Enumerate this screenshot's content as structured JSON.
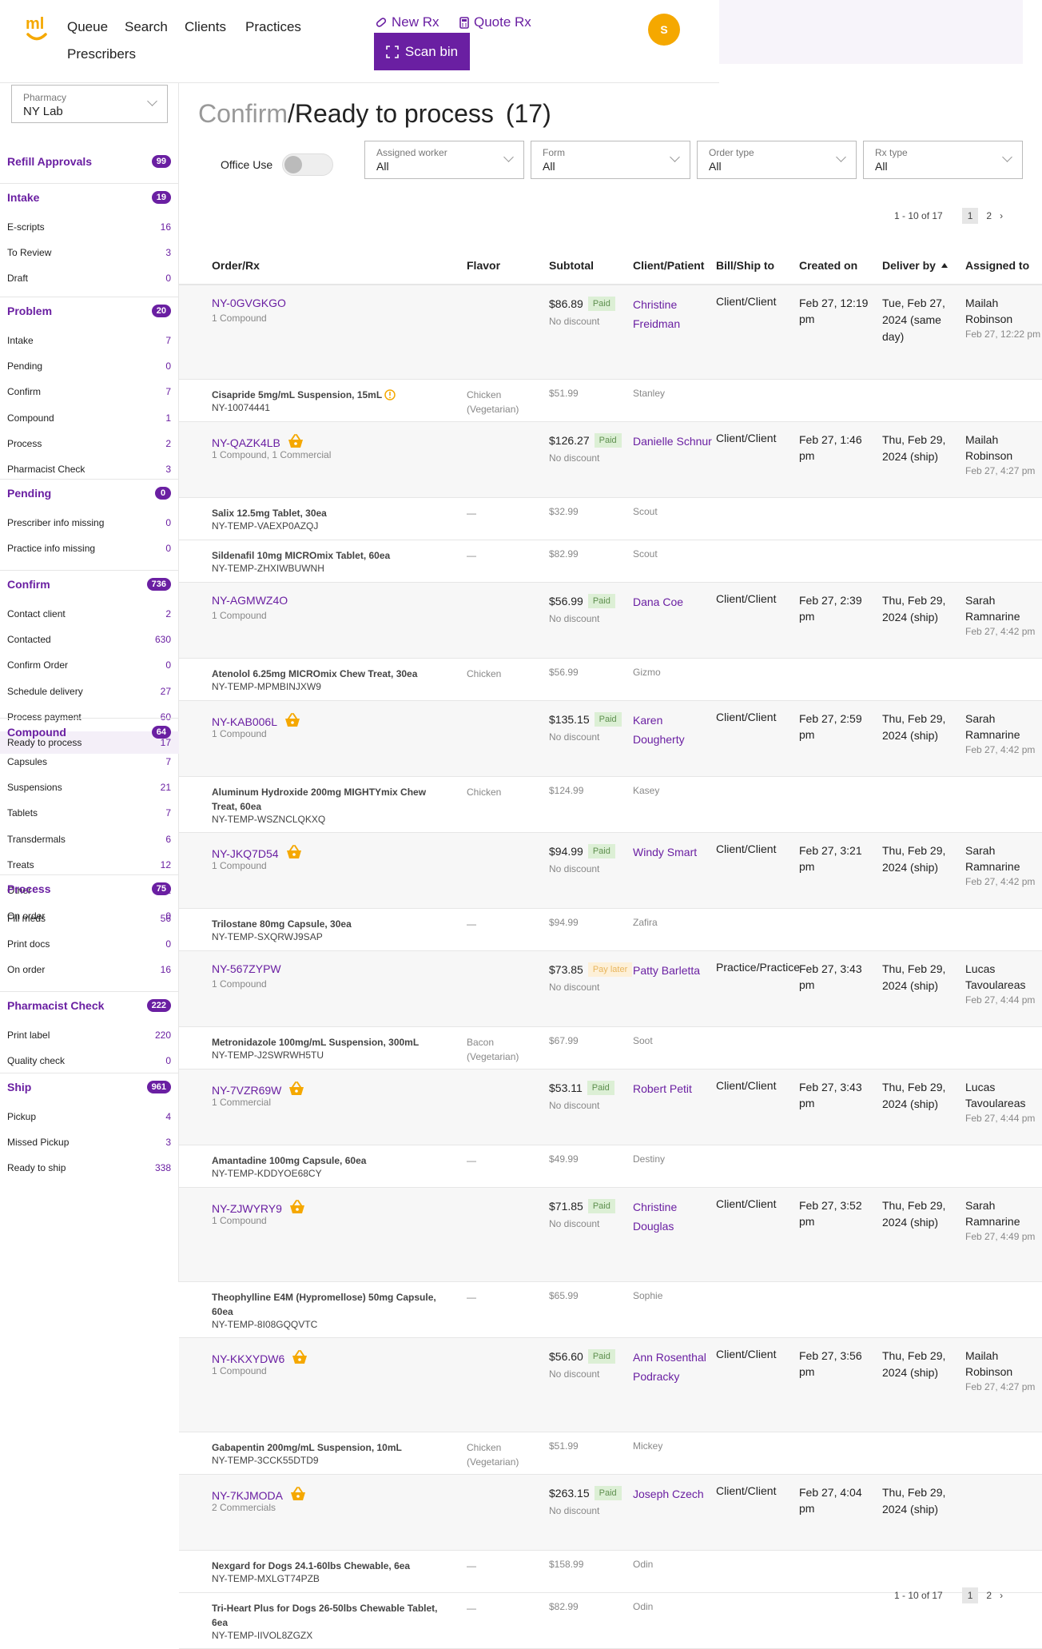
{
  "nav": {
    "queue": "Queue",
    "search": "Search",
    "clients": "Clients",
    "practices": "Practices",
    "prescribers": "Prescribers",
    "new_rx": "New Rx",
    "quote_rx": "Quote Rx",
    "scan_bin": "Scan bin",
    "avatar": "S"
  },
  "pharmacy": {
    "label": "Pharmacy",
    "value": "NY Lab"
  },
  "sidebar": [
    {
      "label": "Refill Approvals",
      "count": "99",
      "items": []
    },
    {
      "label": "Intake",
      "count": "19",
      "items": [
        {
          "label": "E-scripts",
          "count": "16"
        },
        {
          "label": "To Review",
          "count": "3"
        },
        {
          "label": "Draft",
          "count": "0"
        }
      ]
    },
    {
      "label": "Problem",
      "count": "20",
      "items": [
        {
          "label": "Intake",
          "count": "7"
        },
        {
          "label": "Pending",
          "count": "0"
        },
        {
          "label": "Confirm",
          "count": "7"
        },
        {
          "label": "Compound",
          "count": "1"
        },
        {
          "label": "Process",
          "count": "2"
        },
        {
          "label": "Pharmacist Check",
          "count": "3"
        }
      ]
    },
    {
      "label": "Pending",
      "count": "0",
      "items": [
        {
          "label": "Prescriber info missing",
          "count": "0"
        },
        {
          "label": "Practice info missing",
          "count": "0"
        }
      ]
    },
    {
      "label": "Confirm",
      "count": "736",
      "items": [
        {
          "label": "Contact client",
          "count": "2"
        },
        {
          "label": "Contacted",
          "count": "630"
        },
        {
          "label": "Confirm Order",
          "count": "0"
        },
        {
          "label": "Schedule delivery",
          "count": "27"
        },
        {
          "label": "Process payment",
          "count": "60"
        },
        {
          "label": "Ready to process",
          "count": "17"
        }
      ]
    },
    {
      "label": "Compound",
      "count": "64",
      "items": [
        {
          "label": "Capsules",
          "count": "7"
        },
        {
          "label": "Suspensions",
          "count": "21"
        },
        {
          "label": "Tablets",
          "count": "7"
        },
        {
          "label": "Transdermals",
          "count": "6"
        },
        {
          "label": "Treats",
          "count": "12"
        },
        {
          "label": "Other",
          "count": "11"
        },
        {
          "label": "On order",
          "count": "0"
        }
      ]
    },
    {
      "label": "Process",
      "count": "75",
      "items": [
        {
          "label": "Fill meds",
          "count": "56"
        },
        {
          "label": "Print docs",
          "count": "0"
        },
        {
          "label": "On order",
          "count": "16"
        }
      ]
    },
    {
      "label": "Pharmacist Check",
      "count": "222",
      "items": [
        {
          "label": "Print label",
          "count": "220"
        },
        {
          "label": "Quality check",
          "count": "0"
        }
      ]
    },
    {
      "label": "Ship",
      "count": "961",
      "items": [
        {
          "label": "Pickup",
          "count": "4"
        },
        {
          "label": "Missed Pickup",
          "count": "3"
        },
        {
          "label": "Ready to ship",
          "count": "338"
        }
      ]
    }
  ],
  "page": {
    "title_prefix": "Confirm",
    "title_sep": "/",
    "title": "Ready to process",
    "count": "(17)",
    "office_use": "Office Use"
  },
  "filters": [
    {
      "label": "Assigned worker",
      "value": "All"
    },
    {
      "label": "Form",
      "value": "All"
    },
    {
      "label": "Order type",
      "value": "All"
    },
    {
      "label": "Rx type",
      "value": "All"
    }
  ],
  "pagination": {
    "range": "1 - 10 of 17",
    "page1": "1",
    "page2": "2",
    "next": "›"
  },
  "columns": {
    "order": "Order/Rx",
    "flavor": "Flavor",
    "subtotal": "Subtotal",
    "client": "Client/Patient",
    "bill": "Bill/Ship to",
    "created": "Created on",
    "deliver": "Deliver by",
    "assigned": "Assigned to"
  },
  "orders": [
    {
      "id": "NY-0GVGKGO",
      "sub": "1 Compound",
      "basket": false,
      "price": "$86.89",
      "status": "Paid",
      "discount": "No discount",
      "client": "Christine Freidman",
      "bill": "Client/Client",
      "created": "Feb 27, 12:19 pm",
      "deliver": "Tue, Feb 27, 2024 (same day)",
      "assigned": "Mailah Robinson",
      "assigned_at": "Feb 27, 12:22 pm",
      "items": [
        {
          "name": "Cisapride 5mg/mL Suspension, 15mL",
          "warn": true,
          "rx": "NY-10074441",
          "flavor": "Chicken (Vegetarian)",
          "price": "$51.99",
          "pet": "Stanley"
        }
      ]
    },
    {
      "id": "NY-QAZK4LB",
      "sub": "1 Compound, 1 Commercial",
      "basket": true,
      "price": "$126.27",
      "status": "Paid",
      "discount": "No discount",
      "client": "Danielle Schnur",
      "bill": "Client/Client",
      "created": "Feb 27, 1:46 pm",
      "deliver": "Thu, Feb 29, 2024 (ship)",
      "assigned": "Mailah Robinson",
      "assigned_at": "Feb 27, 4:27 pm",
      "items": [
        {
          "name": "Salix 12.5mg Tablet, 30ea",
          "warn": false,
          "rx": "NY-TEMP-VAEXP0AZQJ",
          "flavor": "—",
          "price": "$32.99",
          "pet": "Scout"
        },
        {
          "name": "Sildenafil 10mg MICROmix Tablet, 60ea",
          "warn": false,
          "rx": "NY-TEMP-ZHXIWBUWNH",
          "flavor": "—",
          "price": "$82.99",
          "pet": "Scout"
        }
      ]
    },
    {
      "id": "NY-AGMWZ4O",
      "sub": "1 Compound",
      "basket": false,
      "price": "$56.99",
      "status": "Paid",
      "discount": "No discount",
      "client": "Dana Coe",
      "bill": "Client/Client",
      "created": "Feb 27, 2:39 pm",
      "deliver": "Thu, Feb 29, 2024 (ship)",
      "assigned": "Sarah Ramnarine",
      "assigned_at": "Feb 27, 4:42 pm",
      "items": [
        {
          "name": "Atenolol 6.25mg MICROmix Chew Treat, 30ea",
          "warn": false,
          "rx": "NY-TEMP-MPMBINJXW9",
          "flavor": "Chicken",
          "price": "$56.99",
          "pet": "Gizmo"
        }
      ]
    },
    {
      "id": "NY-KAB006L",
      "sub": "1 Compound",
      "basket": true,
      "price": "$135.15",
      "status": "Paid",
      "discount": "No discount",
      "client": "Karen Dougherty",
      "bill": "Client/Client",
      "created": "Feb 27, 2:59 pm",
      "deliver": "Thu, Feb 29, 2024 (ship)",
      "assigned": "Sarah Ramnarine",
      "assigned_at": "Feb 27, 4:42 pm",
      "items": [
        {
          "name": "Aluminum Hydroxide 200mg MIGHTYmix Chew Treat, 60ea",
          "warn": false,
          "rx": "NY-TEMP-WSZNCLQKXQ",
          "flavor": "Chicken",
          "price": "$124.99",
          "pet": "Kasey"
        }
      ]
    },
    {
      "id": "NY-JKQ7D54",
      "sub": "1 Compound",
      "basket": true,
      "price": "$94.99",
      "status": "Paid",
      "discount": "No discount",
      "client": "Windy Smart",
      "bill": "Client/Client",
      "created": "Feb 27, 3:21 pm",
      "deliver": "Thu, Feb 29, 2024 (ship)",
      "assigned": "Sarah Ramnarine",
      "assigned_at": "Feb 27, 4:42 pm",
      "items": [
        {
          "name": "Trilostane 80mg Capsule, 30ea",
          "warn": false,
          "rx": "NY-TEMP-SXQRWJ9SAP",
          "flavor": "—",
          "price": "$94.99",
          "pet": "Zafira"
        }
      ]
    },
    {
      "id": "NY-567ZYPW",
      "sub": "1 Compound",
      "basket": false,
      "price": "$73.85",
      "status": "Pay later",
      "discount": "No discount",
      "client": "Patty Barletta",
      "bill": "Practice/Practice",
      "created": "Feb 27, 3:43 pm",
      "deliver": "Thu, Feb 29, 2024 (ship)",
      "assigned": "Lucas Tavoulareas",
      "assigned_at": "Feb 27, 4:44 pm",
      "items": [
        {
          "name": "Metronidazole 100mg/mL Suspension, 300mL",
          "warn": false,
          "rx": "NY-TEMP-J2SWRWH5TU",
          "flavor": "Bacon (Vegetarian)",
          "price": "$67.99",
          "pet": "Soot"
        }
      ]
    },
    {
      "id": "NY-7VZR69W",
      "sub": "1 Commercial",
      "basket": true,
      "price": "$53.11",
      "status": "Paid",
      "discount": "No discount",
      "client": "Robert Petit",
      "bill": "Client/Client",
      "created": "Feb 27, 3:43 pm",
      "deliver": "Thu, Feb 29, 2024 (ship)",
      "assigned": "Lucas Tavoulareas",
      "assigned_at": "Feb 27, 4:44 pm",
      "items": [
        {
          "name": "Amantadine 100mg Capsule, 60ea",
          "warn": false,
          "rx": "NY-TEMP-KDDYOE68CY",
          "flavor": "—",
          "price": "$49.99",
          "pet": "Destiny"
        }
      ]
    },
    {
      "id": "NY-ZJWYRY9",
      "sub": "1 Compound",
      "basket": true,
      "price": "$71.85",
      "status": "Paid",
      "discount": "No discount",
      "client": "Christine Douglas",
      "bill": "Client/Client",
      "created": "Feb 27, 3:52 pm",
      "deliver": "Thu, Feb 29, 2024 (ship)",
      "assigned": "Sarah Ramnarine",
      "assigned_at": "Feb 27, 4:49 pm",
      "items": [
        {
          "name": "Theophylline E4M (Hypromellose) 50mg Capsule, 60ea",
          "warn": false,
          "rx": "NY-TEMP-8I08GQQVTC",
          "flavor": "—",
          "price": "$65.99",
          "pet": "Sophie"
        }
      ]
    },
    {
      "id": "NY-KKXYDW6",
      "sub": "1 Compound",
      "basket": true,
      "price": "$56.60",
      "status": "Paid",
      "discount": "No discount",
      "client": "Ann Rosenthal Podracky",
      "bill": "Client/Client",
      "created": "Feb 27, 3:56 pm",
      "deliver": "Thu, Feb 29, 2024 (ship)",
      "assigned": "Mailah Robinson",
      "assigned_at": "Feb 27, 4:27 pm",
      "items": [
        {
          "name": "Gabapentin 200mg/mL Suspension, 10mL",
          "warn": false,
          "rx": "NY-TEMP-3CCK55DTD9",
          "flavor": "Chicken (Vegetarian)",
          "price": "$51.99",
          "pet": "Mickey"
        }
      ]
    },
    {
      "id": "NY-7KJMODA",
      "sub": "2 Commercials",
      "basket": true,
      "price": "$263.15",
      "status": "Paid",
      "discount": "No discount",
      "client": "Joseph Czech",
      "bill": "Client/Client",
      "created": "Feb 27, 4:04 pm",
      "deliver": "Thu, Feb 29, 2024 (ship)",
      "assigned": "",
      "assigned_at": "",
      "items": [
        {
          "name": "Nexgard for Dogs 24.1-60lbs Chewable, 6ea",
          "warn": false,
          "rx": "NY-TEMP-MXLGT74PZB",
          "flavor": "—",
          "price": "$158.99",
          "pet": "Odin"
        },
        {
          "name": "Tri-Heart Plus for Dogs 26-50lbs Chewable Tablet, 6ea",
          "warn": false,
          "rx": "NY-TEMP-IIVOL8ZGZX",
          "flavor": "—",
          "price": "$82.99",
          "pet": "Odin"
        }
      ]
    }
  ],
  "colors": {
    "accent": "#6a1fa2",
    "avatar": "#f5a800",
    "paid_bg": "#dcefd5",
    "paylater_bg": "#fdf0d8"
  }
}
